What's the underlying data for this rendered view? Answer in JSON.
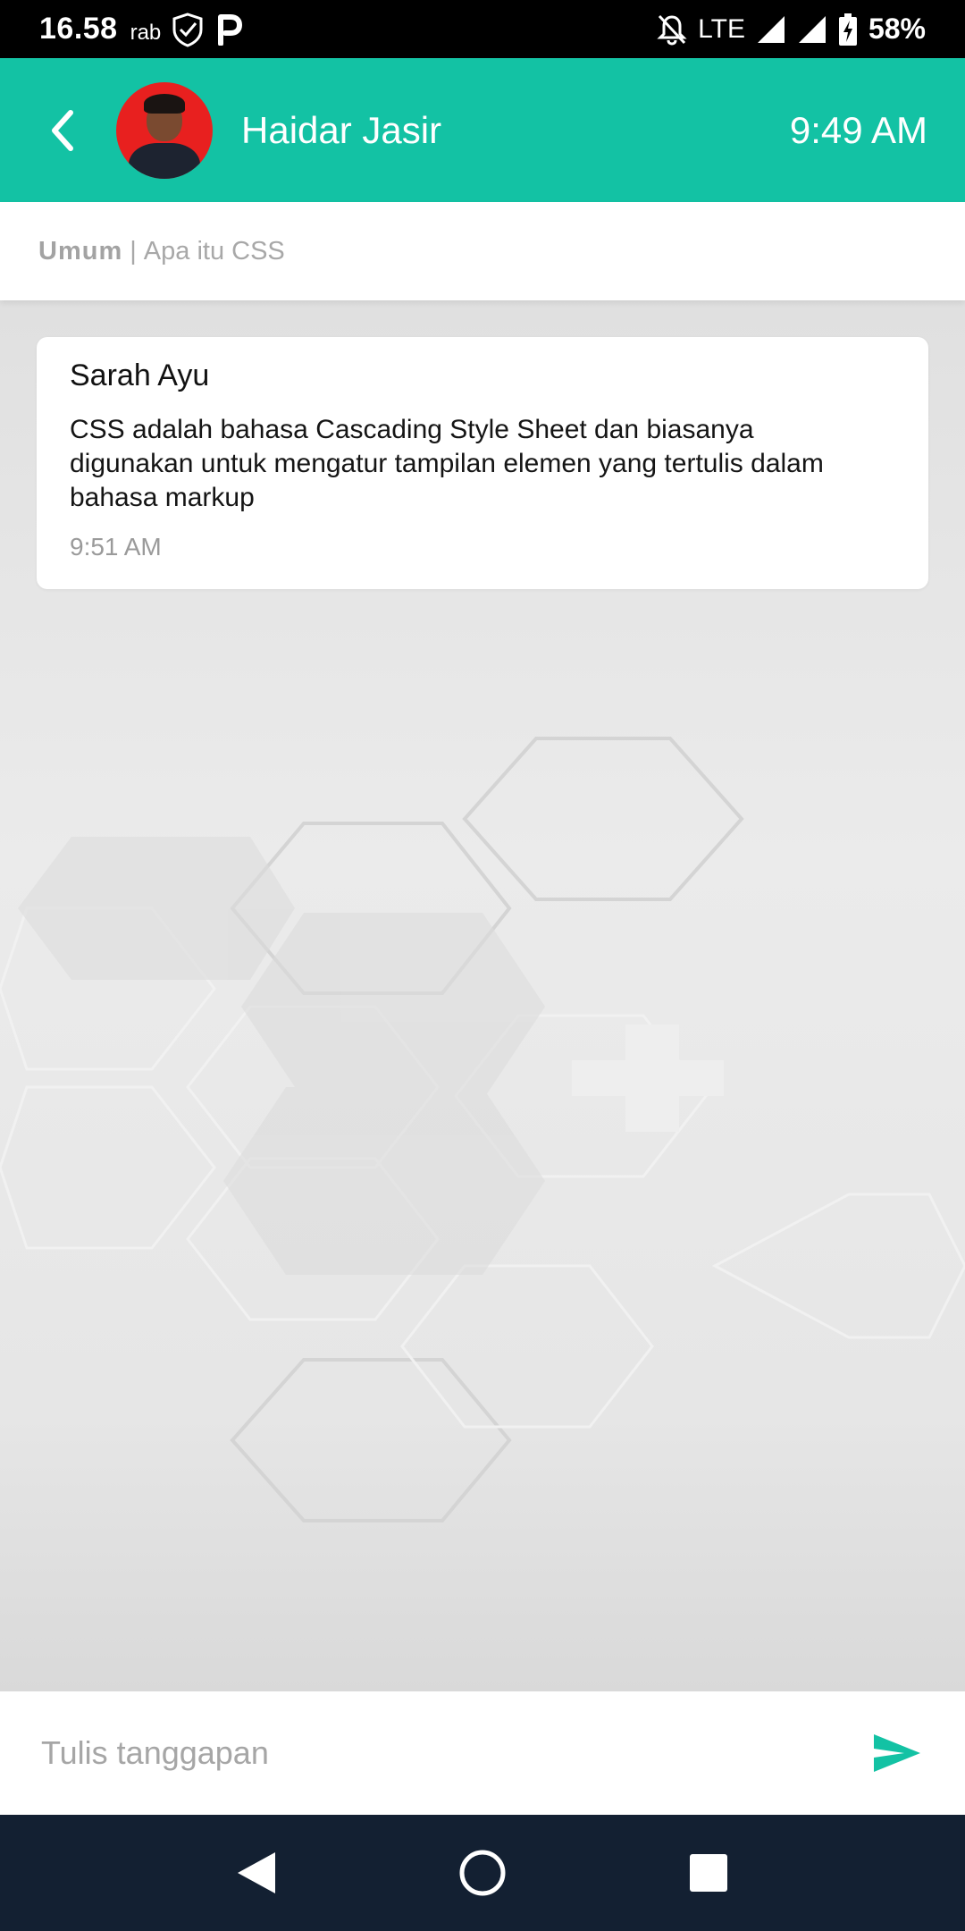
{
  "status_bar": {
    "time": "16.58",
    "day": "rab",
    "network": "LTE",
    "battery": "58%",
    "icons": [
      "shield-check-icon",
      "parking-icon",
      "notifications-off-icon",
      "signal-icon",
      "battery-charging-icon"
    ]
  },
  "header": {
    "contact_name": "Haidar Jasir",
    "time": "9:49 AM",
    "accent_color": "#13c2a4"
  },
  "topic": {
    "category": "Umum",
    "separator": "|",
    "title": "Apa itu CSS"
  },
  "messages": [
    {
      "sender": "Sarah Ayu",
      "text": "CSS adalah bahasa Cascading Style Sheet dan biasanya digunakan untuk mengatur tampilan elemen yang tertulis dalam bahasa markup",
      "time": "9:51 AM"
    }
  ],
  "input": {
    "placeholder": "Tulis tanggapan",
    "value": ""
  },
  "nav": {
    "icons": [
      "nav-back-icon",
      "nav-home-icon",
      "nav-recents-icon"
    ]
  }
}
